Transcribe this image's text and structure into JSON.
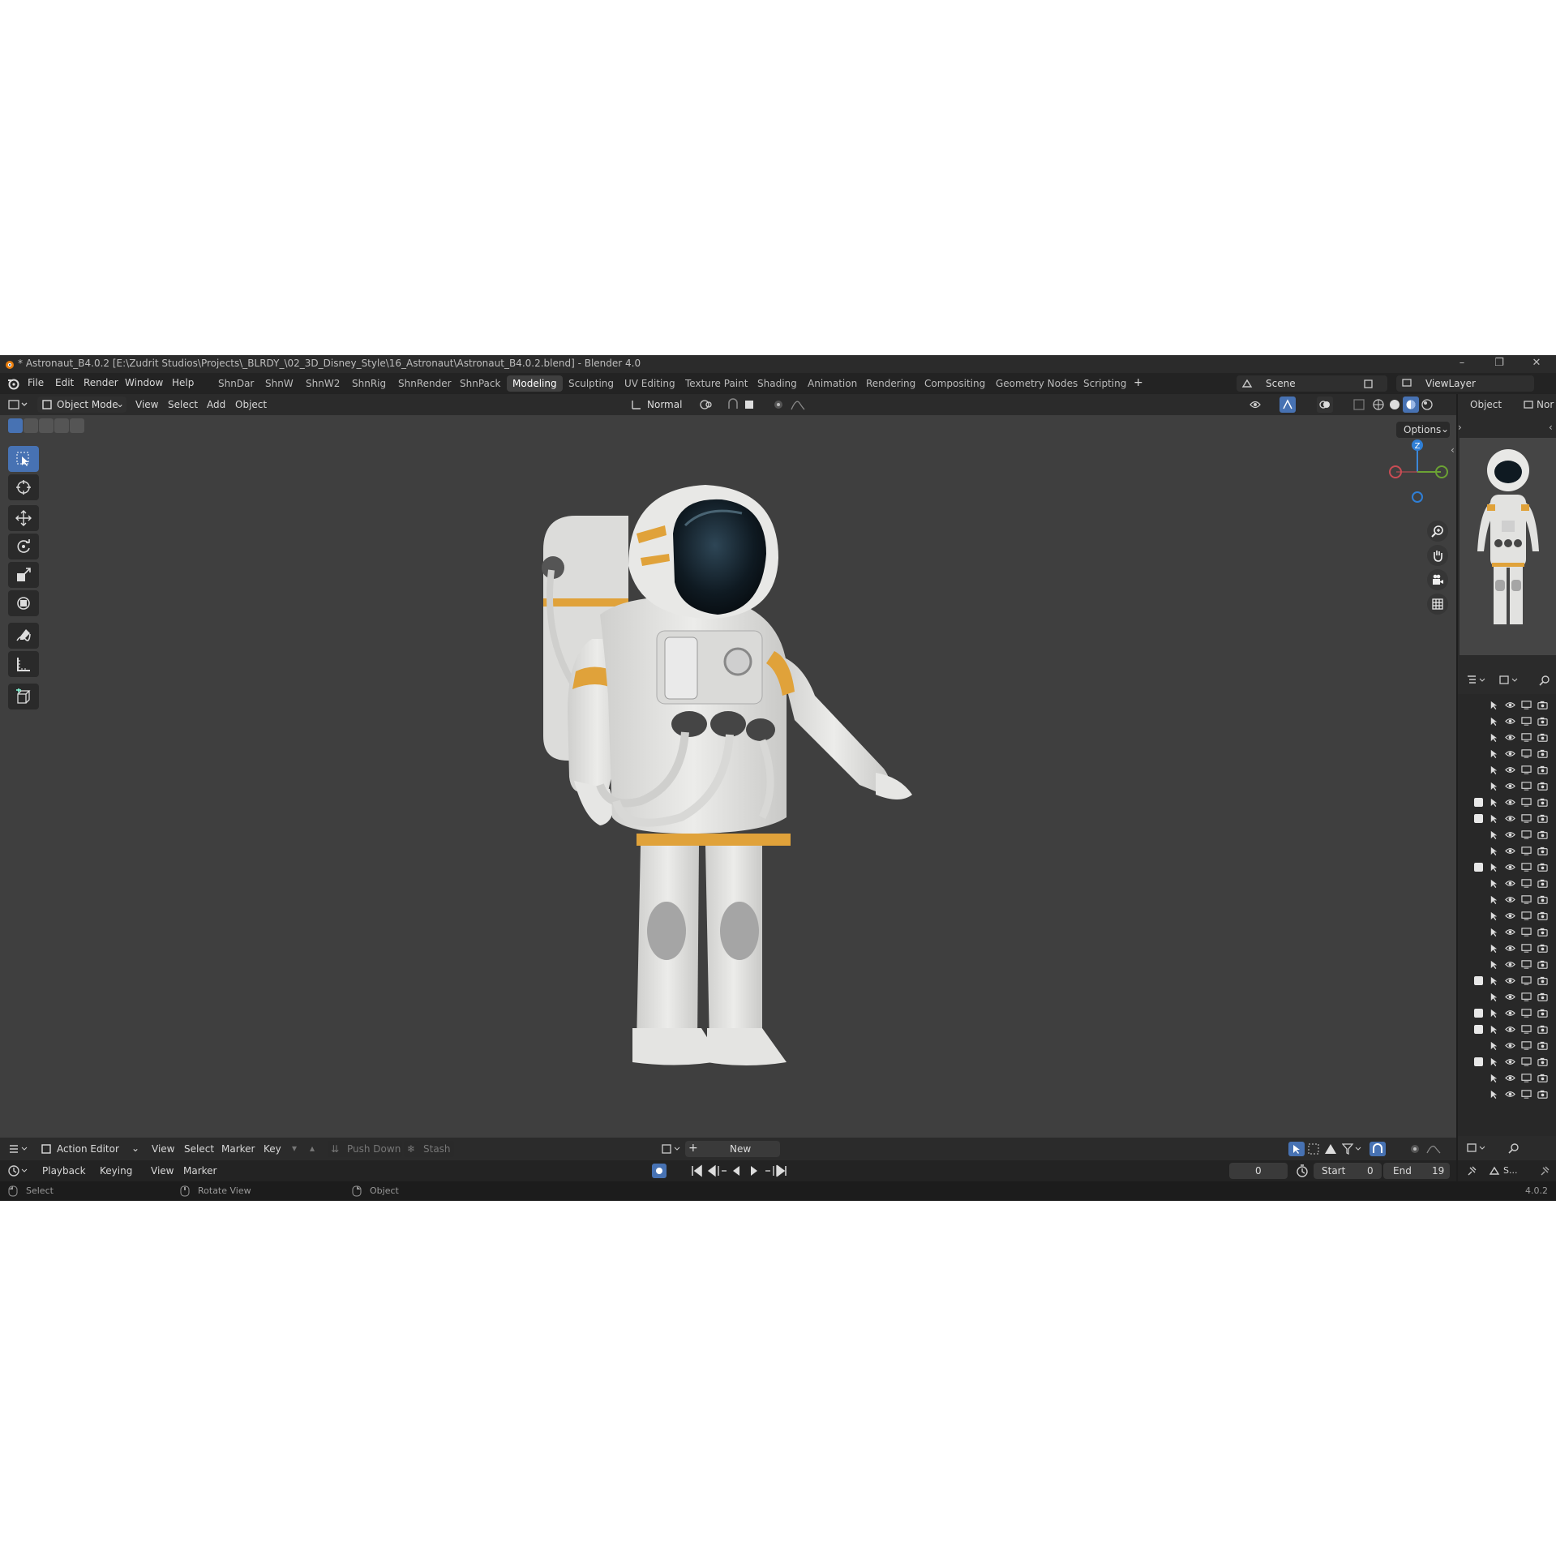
{
  "window": {
    "title": "* Astronaut_B4.0.2 [E:\\Zudrit Studios\\Projects\\_BLRDY_\\02_3D_Disney_Style\\16_Astronaut\\Astronaut_B4.0.2.blend] - Blender 4.0",
    "minimize": "–",
    "maximize": "❐",
    "close": "✕"
  },
  "menu": [
    "File",
    "Edit",
    "Render",
    "Window",
    "Help"
  ],
  "workspaces": [
    "ShnDar",
    "ShnW",
    "ShnW2",
    "ShnRig",
    "ShnRender",
    "ShnPack",
    "Modeling",
    "Sculpting",
    "UV Editing",
    "Texture Paint",
    "Shading",
    "Animation",
    "Rendering",
    "Compositing",
    "Geometry Nodes",
    "Scripting"
  ],
  "active_workspace": "Modeling",
  "add_workspace": "+",
  "scene": {
    "name": "Scene",
    "view_layer": "ViewLayer"
  },
  "header3d": {
    "mode": "Object Mode",
    "menus": [
      "View",
      "Select",
      "Add",
      "Object"
    ],
    "orientation": "Normal",
    "options": "Options"
  },
  "gizmo": {
    "z": "Z"
  },
  "sidebar": {
    "tab_object": "Object",
    "tab_normal": "Nor"
  },
  "outliner_rows": [
    {
      "checkbox": false
    },
    {
      "checkbox": false
    },
    {
      "checkbox": false
    },
    {
      "checkbox": false
    },
    {
      "checkbox": false
    },
    {
      "checkbox": false
    },
    {
      "checkbox": true
    },
    {
      "checkbox": true
    },
    {
      "checkbox": false
    },
    {
      "checkbox": false
    },
    {
      "checkbox": true
    },
    {
      "checkbox": false
    },
    {
      "checkbox": false
    },
    {
      "checkbox": false
    },
    {
      "checkbox": false
    },
    {
      "checkbox": false
    },
    {
      "checkbox": false
    },
    {
      "checkbox": true
    },
    {
      "checkbox": false
    },
    {
      "checkbox": true
    },
    {
      "checkbox": true
    },
    {
      "checkbox": false
    },
    {
      "checkbox": true
    },
    {
      "checkbox": false
    },
    {
      "checkbox": false
    }
  ],
  "action_editor": {
    "editor": "Action Editor",
    "menus": [
      "View",
      "Select",
      "Marker",
      "Key"
    ],
    "push_down": "Push Down",
    "stash": "Stash",
    "new": "New"
  },
  "timeline": {
    "menus": [
      "Playback",
      "Keying",
      "View",
      "Marker"
    ],
    "current_frame": "0",
    "start_label": "Start",
    "start": "0",
    "end_label": "End",
    "end": "19",
    "scene_short": "S..."
  },
  "status": {
    "select": "Select",
    "rotate": "Rotate View",
    "object": "Object",
    "version": "4.0.2"
  },
  "colors": {
    "accent": "#4772b3",
    "suit_orange": "#e0a23a",
    "suit_white": "#e6e6e4"
  }
}
